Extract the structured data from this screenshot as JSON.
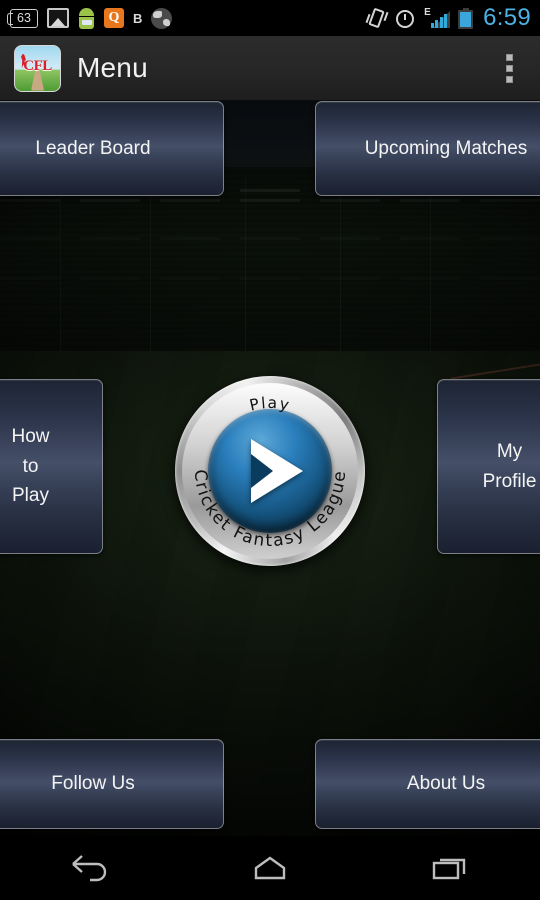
{
  "status_bar": {
    "icons_left": [
      {
        "name": "notification-count-icon",
        "label": "63"
      },
      {
        "name": "gallery-icon",
        "label": ""
      },
      {
        "name": "android-system-icon",
        "label": ""
      },
      {
        "name": "quickoffice-icon",
        "label": "Q"
      },
      {
        "name": "bluetooth-tether-icon",
        "label": "B"
      },
      {
        "name": "browser-icon",
        "label": ""
      }
    ],
    "icons_right": [
      {
        "name": "vibrate-mode-icon",
        "label": ""
      },
      {
        "name": "alarm-icon",
        "label": ""
      },
      {
        "name": "signal-icon",
        "label": "E"
      },
      {
        "name": "battery-icon",
        "label": ""
      }
    ],
    "time": "6:59"
  },
  "action_bar": {
    "app_icon_name": "cfl-app-icon",
    "app_icon_text": "CFL",
    "title": "Menu",
    "overflow_icon": "overflow-menu-icon"
  },
  "menu": {
    "top_row": [
      {
        "name": "leader-board-button",
        "label": "Leader Board"
      },
      {
        "name": "upcoming-matches-button",
        "label": "Upcoming Matches"
      }
    ],
    "left_button": {
      "name": "how-to-play-button",
      "lines": [
        "How",
        "to",
        "Play"
      ]
    },
    "right_button": {
      "name": "my-profile-button",
      "lines": [
        "My",
        "Profile"
      ]
    },
    "bottom_row": [
      {
        "name": "follow-us-button",
        "label": "Follow Us"
      },
      {
        "name": "about-us-button",
        "label": "About Us"
      }
    ],
    "play_button": {
      "name": "play-button",
      "top_text": "Play",
      "bottom_text": "Cricket Fantasy League",
      "arrow_icon": "play-arrow-icon"
    }
  },
  "nav_bar": {
    "keys": [
      {
        "name": "back-button",
        "label": "Back"
      },
      {
        "name": "home-button",
        "label": "Home"
      },
      {
        "name": "recent-apps-button",
        "label": "Recent apps"
      }
    ]
  },
  "colors": {
    "accent_blue": "#4cb2e2",
    "button_blue": "#454f68",
    "pitch_green": "#151f11",
    "logo_red": "#d81f26"
  }
}
